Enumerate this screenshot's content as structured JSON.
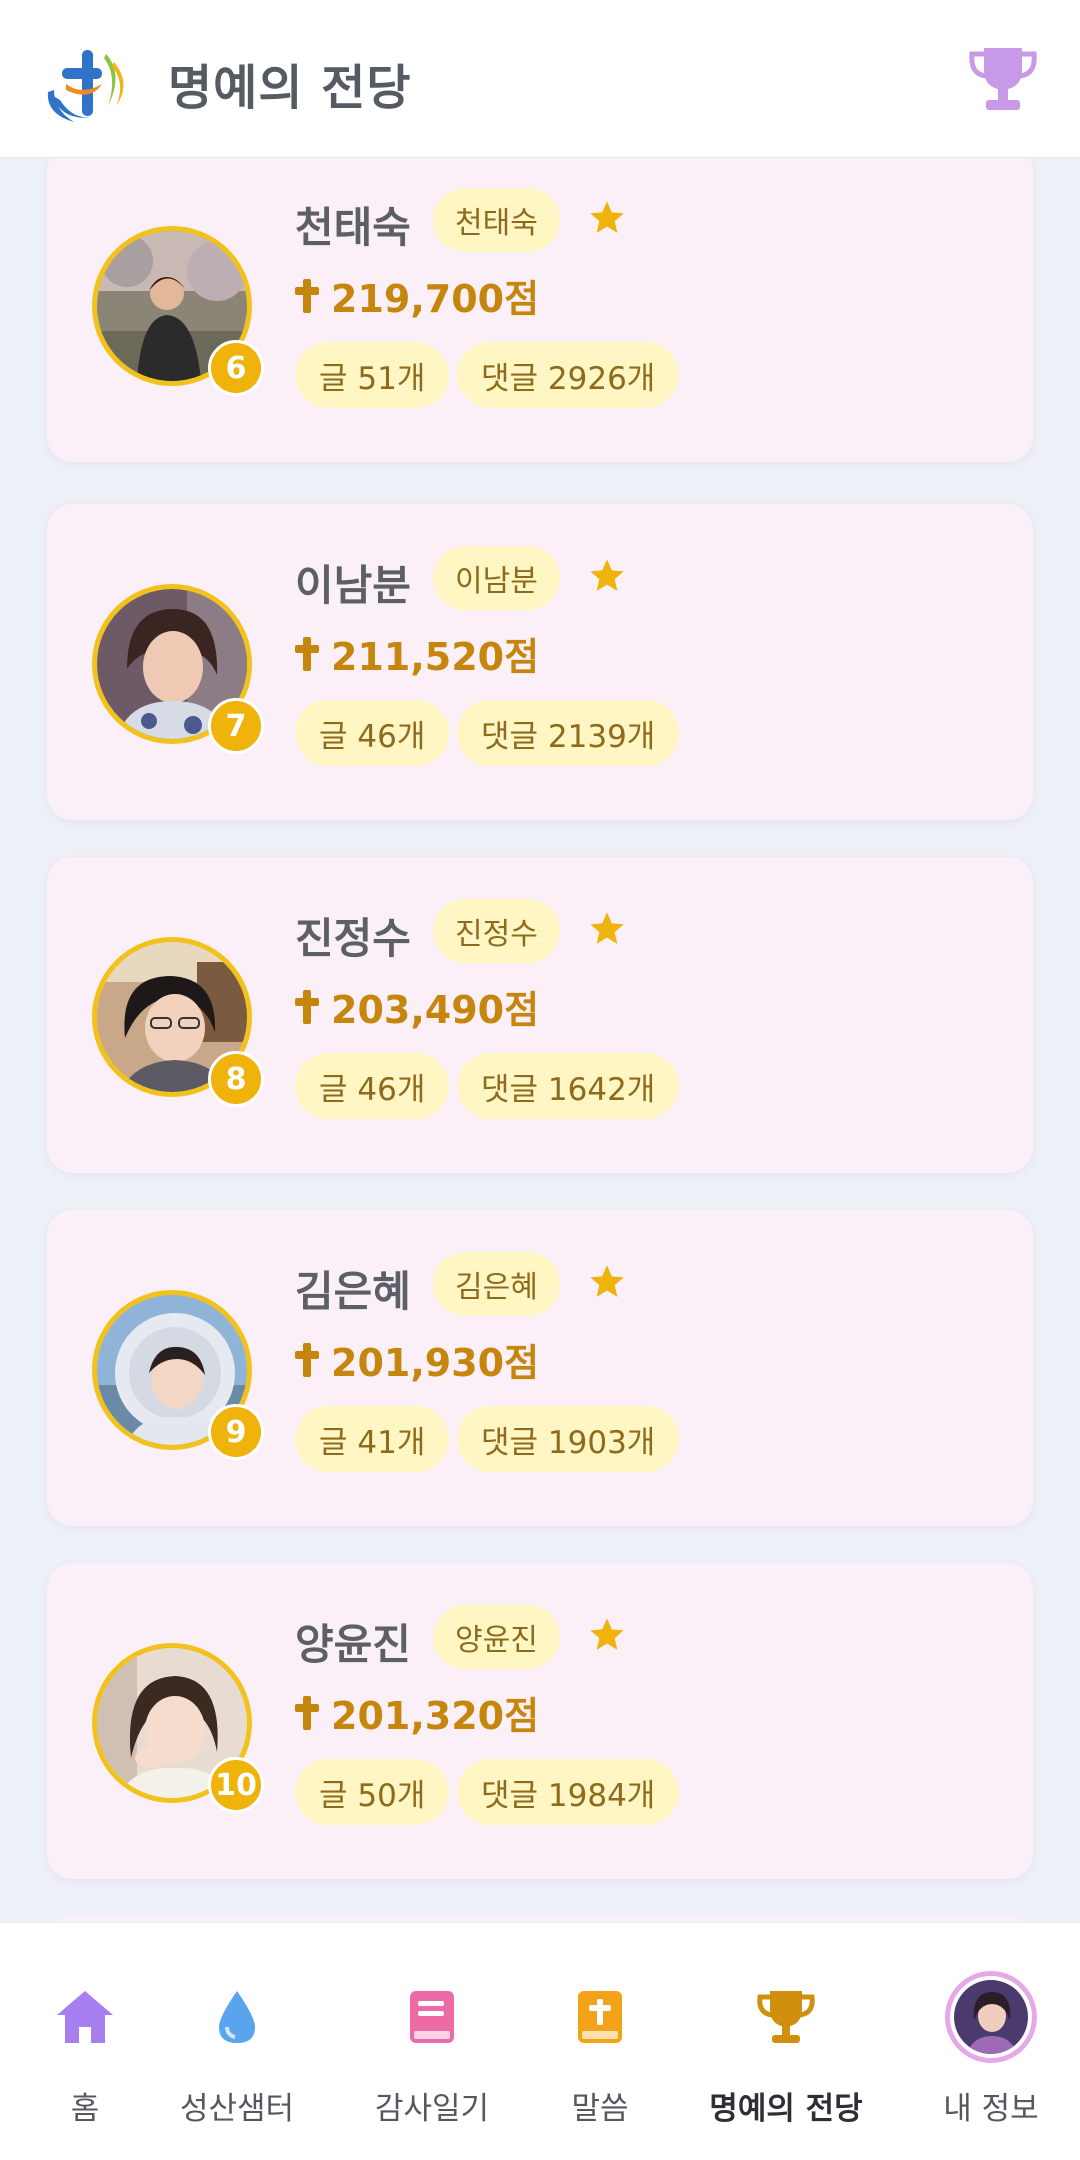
{
  "header": {
    "title": "명예의 전당",
    "logo_icon": "hanaro-logo",
    "action_icon": "trophy-icon"
  },
  "ranking": [
    {
      "rank": "6",
      "name": "천태숙",
      "nickname": "천태숙",
      "points": "219,700점",
      "posts": "글 51개",
      "comments": "댓글 2926개"
    },
    {
      "rank": "7",
      "name": "이남분",
      "nickname": "이남분",
      "points": "211,520점",
      "posts": "글 46개",
      "comments": "댓글 2139개"
    },
    {
      "rank": "8",
      "name": "진정수",
      "nickname": "진정수",
      "points": "203,490점",
      "posts": "글 46개",
      "comments": "댓글 1642개"
    },
    {
      "rank": "9",
      "name": "김은혜",
      "nickname": "김은혜",
      "points": "201,930점",
      "posts": "글 41개",
      "comments": "댓글 1903개"
    },
    {
      "rank": "10",
      "name": "양윤진",
      "nickname": "양윤진",
      "points": "201,320점",
      "posts": "글 50개",
      "comments": "댓글 1984개"
    }
  ],
  "nav": {
    "items": [
      {
        "label": "홈",
        "icon": "home-icon"
      },
      {
        "label": "성산샘터",
        "icon": "water-drop-icon"
      },
      {
        "label": "감사일기",
        "icon": "book-icon"
      },
      {
        "label": "말씀",
        "icon": "bible-icon"
      },
      {
        "label": "명예의 전당",
        "icon": "trophy-icon",
        "active": true
      },
      {
        "label": "내 정보",
        "icon": "profile-avatar"
      }
    ]
  },
  "colors": {
    "accent_gold": "#efb30b",
    "points_text": "#c6860e",
    "card_bg": "#fcf0f8",
    "pill_bg": "#fff6c4",
    "trophy_header": "#c79ae8",
    "home_icon": "#a77ff0",
    "drop_icon": "#5aa3ee",
    "book_icon": "#ee6aa6",
    "bible_icon": "#f4a21a",
    "trophy_nav": "#d18f0e"
  }
}
